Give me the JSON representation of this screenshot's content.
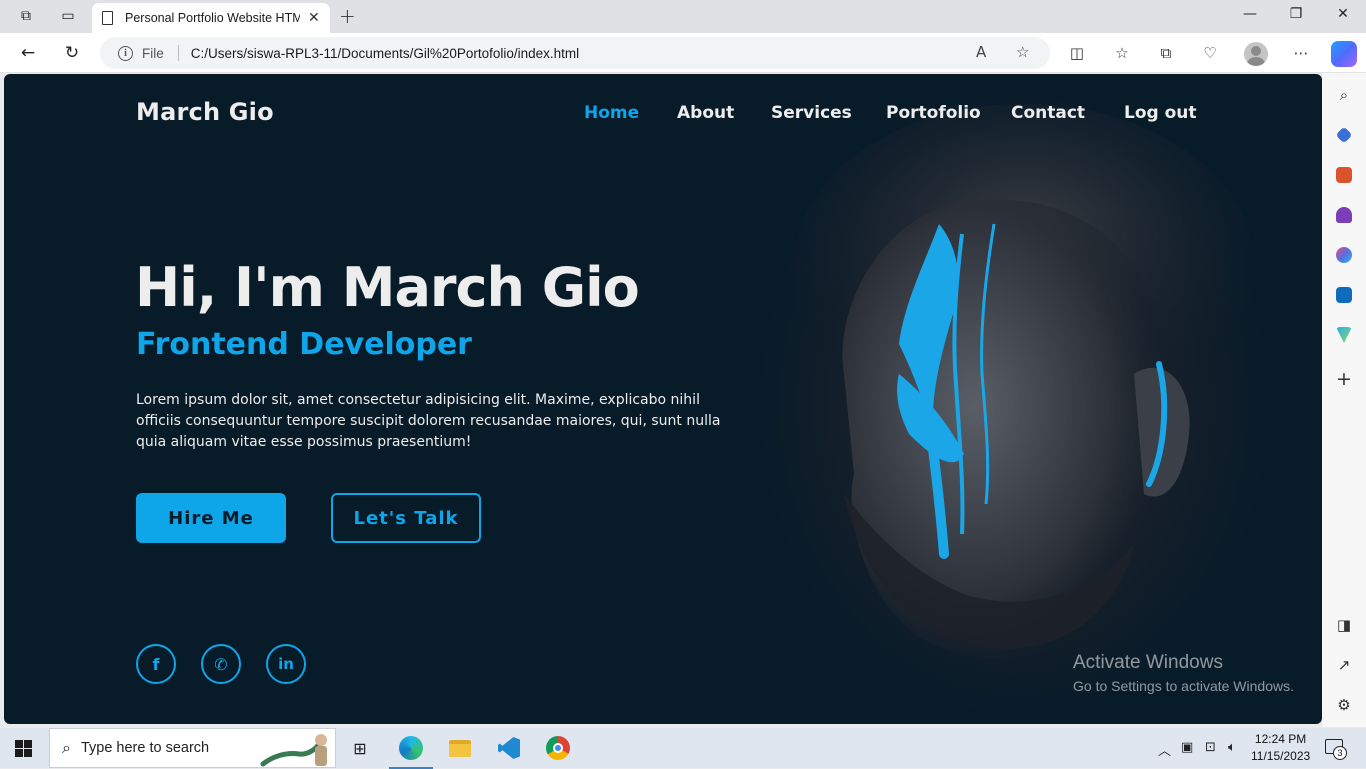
{
  "browser": {
    "tab_title": "Personal Portfolio Website HTML",
    "address_scheme_label": "File",
    "address_url": "C:/Users/siswa-RPL3-11/Documents/Gil%20Portofolio/index.html"
  },
  "site": {
    "logo": "March Gio",
    "nav": [
      "Home",
      "About",
      "Services",
      "Portofolio",
      "Contact",
      "Log out"
    ],
    "active_nav": "Home",
    "hero": {
      "title": "Hi, I'm March Gio",
      "subtitle": "Frontend Developer",
      "description": "Lorem ipsum dolor sit, amet consectetur adipisicing elit. Maxime, explicabo nihil officiis consequuntur tempore suscipit dolorem recusandae maiores, qui, sunt nulla quia aliquam vitae esse possimus praesentium!",
      "primary_button": "Hire Me",
      "secondary_button": "Let's Talk"
    },
    "social": [
      {
        "name": "facebook-icon",
        "glyph": "f"
      },
      {
        "name": "whatsapp-icon",
        "glyph": "✆"
      },
      {
        "name": "linkedin-icon",
        "glyph": "in"
      }
    ],
    "accent_color": "#0ea5e9",
    "background_color": "#081b29"
  },
  "watermark": {
    "line1": "Activate Windows",
    "line2": "Go to Settings to activate Windows."
  },
  "taskbar": {
    "search_placeholder": "Type here to search",
    "time": "12:24 PM",
    "date": "11/15/2023",
    "notification_count": "3"
  }
}
